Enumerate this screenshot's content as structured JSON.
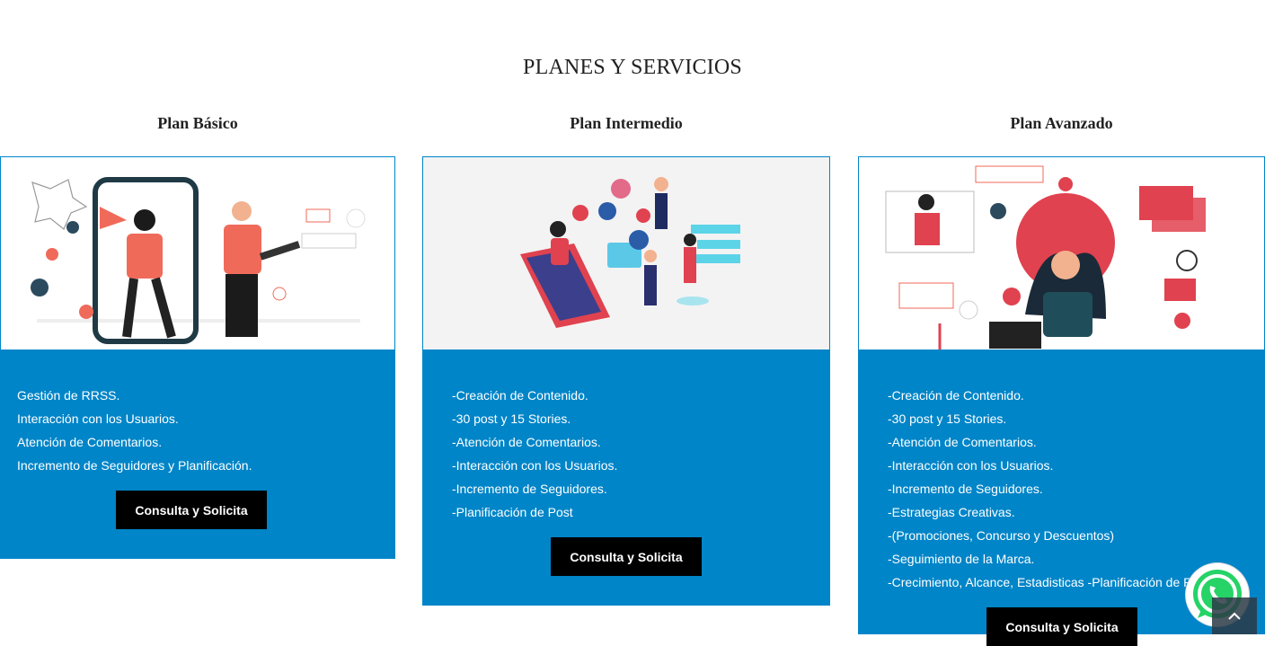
{
  "section_title": "PLANES Y SERVICIOS",
  "plans": [
    {
      "name": "Plan Básico",
      "features": [
        "Gestión de RRSS.",
        "Interacción con los Usuarios.",
        "Atención de Comentarios.",
        "Incremento de Seguidores y Planificación."
      ],
      "button": "Consulta y Solicita"
    },
    {
      "name": "Plan Intermedio",
      "features": [
        "-Creación de Contenido.",
        "-30 post y 15 Stories.",
        "-Atención de Comentarios.",
        "-Interacción con los Usuarios.",
        "-Incremento de Seguidores.",
        "-Planificación de Post"
      ],
      "button": "Consulta y Solicita"
    },
    {
      "name": "Plan Avanzado",
      "features": [
        "-Creación de Contenido.",
        "-30 post y 15 Stories.",
        "-Atención de Comentarios.",
        "-Interacción con los Usuarios.",
        "-Incremento de Seguidores.",
        "-Estrategias Creativas.",
        "-(Promociones, Concurso y Descuentos)",
        "-Seguimiento de la Marca.",
        "-Crecimiento, Alcance, Estadisticas -Planificación de Post"
      ],
      "button": "Consulta y Solicita"
    }
  ],
  "floating": {
    "whatsapp_icon": "whatsapp-icon",
    "scroll_top_icon": "chevron-up-icon"
  },
  "colors": {
    "accent": "#0085c8",
    "button": "#000000",
    "whatsapp": "#25d366"
  }
}
